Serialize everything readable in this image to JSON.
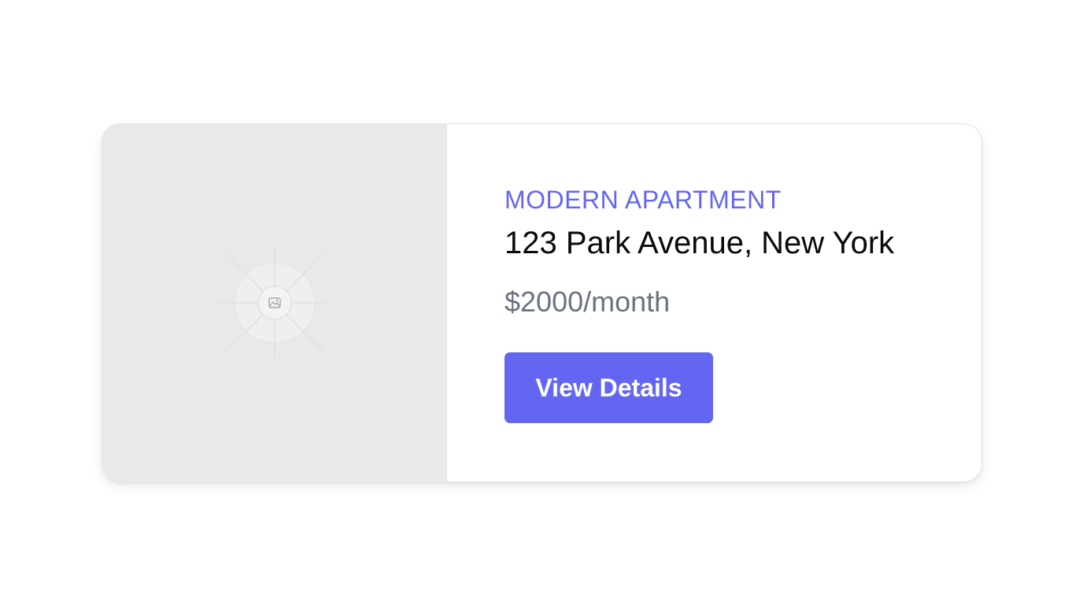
{
  "listing": {
    "category": "MODERN APARTMENT",
    "address": "123 Park Avenue, New York",
    "price": "$2000/month",
    "cta_label": "View Details"
  },
  "media": {
    "icon": "image-placeholder-icon"
  },
  "colors": {
    "accent": "#6366f1",
    "price_text": "#6b7280",
    "media_background": "#e9e9e9"
  }
}
